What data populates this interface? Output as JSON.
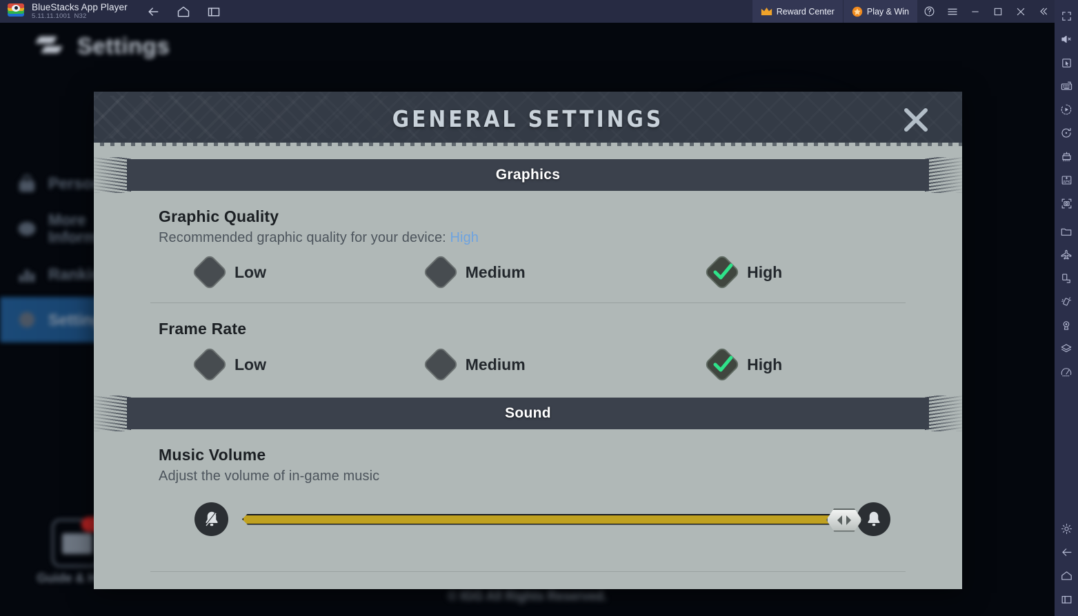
{
  "titlebar": {
    "app_name": "BlueStacks App Player",
    "version": "5.11.11.1001",
    "instance": "N32",
    "nav": [
      {
        "name": "back-icon",
        "label": "Back"
      },
      {
        "name": "home-icon",
        "label": "Home"
      },
      {
        "name": "multi-instance-icon",
        "label": "Multi-instance"
      }
    ],
    "reward_center": "Reward Center",
    "play_and_win": "Play & Win",
    "help_label": "Help",
    "menu_label": "Menu",
    "minimize_label": "Minimize",
    "maximize_label": "Maximize",
    "close_label": "Close",
    "collapse_label": "Collapse"
  },
  "game_background": {
    "page_title": "Settings",
    "sidebar": [
      {
        "label": "Personal info",
        "icon": "lock-icon",
        "active": false
      },
      {
        "label": "More Information",
        "icon": "info-icon",
        "active": false
      },
      {
        "label": "Ranking",
        "icon": "ranking-icon",
        "active": false
      },
      {
        "label": "Settings",
        "icon": "gear-icon",
        "active": true
      }
    ],
    "guide_help": "Guide & Help",
    "copyright": "© IGG All Rights Reserved."
  },
  "modal": {
    "title": "GENERAL SETTINGS",
    "close_label": "Close",
    "sections": [
      {
        "banner": "Graphics",
        "settings": [
          {
            "name": "Graphic Quality",
            "description_prefix": "Recommended graphic quality for your device: ",
            "description_highlight": "High",
            "options": [
              {
                "label": "Low",
                "selected": false
              },
              {
                "label": "Medium",
                "selected": false
              },
              {
                "label": "High",
                "selected": true
              }
            ]
          },
          {
            "name": "Frame Rate",
            "options": [
              {
                "label": "Low",
                "selected": false
              },
              {
                "label": "Medium",
                "selected": false
              },
              {
                "label": "High",
                "selected": true
              }
            ]
          }
        ]
      },
      {
        "banner": "Sound",
        "settings": [
          {
            "name": "Music Volume",
            "description": "Adjust the volume of in-game music",
            "slider": {
              "value_percent": 100,
              "mute_icon": "bell-muted-icon",
              "max_icon": "bell-icon",
              "knob_icon": "left-right-arrows-icon"
            }
          }
        ]
      }
    ]
  },
  "right_rail": {
    "top_icons": [
      {
        "name": "fullscreen-icon",
        "label": "Fullscreen"
      },
      {
        "name": "mute-icon",
        "label": "Mute"
      },
      {
        "name": "cursor-icon",
        "label": "Game controls"
      },
      {
        "name": "keyboard-icon",
        "label": "Keyboard controls"
      },
      {
        "name": "macro-icon",
        "label": "Macro recorder"
      },
      {
        "name": "rotate-icon",
        "label": "Rotate"
      },
      {
        "name": "multi-instance-sync-icon",
        "label": "Multi-instance sync"
      },
      {
        "name": "install-apk-icon",
        "label": "Install APK"
      },
      {
        "name": "screenshot-icon",
        "label": "Screenshot"
      },
      {
        "name": "media-folder-icon",
        "label": "Media manager"
      },
      {
        "name": "airplane-icon",
        "label": "Airplane"
      },
      {
        "name": "rotate-screen-icon",
        "label": "Rotate screen"
      },
      {
        "name": "shake-icon",
        "label": "Shake"
      },
      {
        "name": "location-icon",
        "label": "Location"
      },
      {
        "name": "layers-icon",
        "label": "Eco mode"
      },
      {
        "name": "performance-icon",
        "label": "Performance"
      }
    ],
    "bottom_icons": [
      {
        "name": "gear-icon",
        "label": "Settings"
      },
      {
        "name": "back-icon",
        "label": "Back"
      },
      {
        "name": "home-icon",
        "label": "Home"
      },
      {
        "name": "recents-icon",
        "label": "Recent apps"
      }
    ]
  },
  "colors": {
    "titlebar_bg": "#272b43",
    "panel_bg": "#b0b8b7",
    "banner_bg": "#3b414c",
    "accent_gold": "#c0a120",
    "accent_green": "#2fe28a",
    "link_blue": "#6ea3e0",
    "rail_bg": "#2b2f4a"
  }
}
